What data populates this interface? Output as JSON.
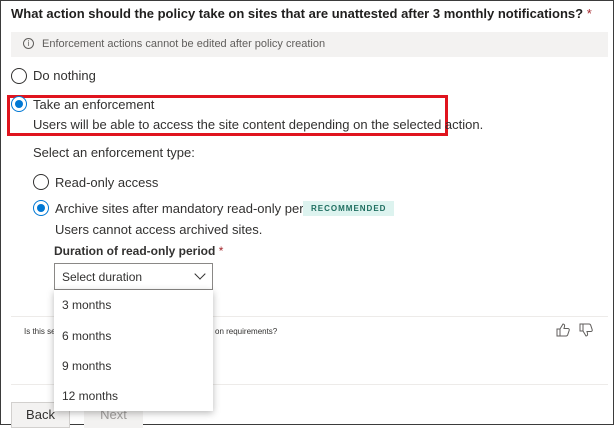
{
  "question": {
    "text": "What action should the policy take on sites that are unattested after 3 monthly notifications?",
    "required_mark": "*"
  },
  "info": {
    "icon": "info-icon",
    "glyph": "i",
    "text": "Enforcement actions cannot be edited after policy creation"
  },
  "options": {
    "do_nothing": {
      "label": "Do nothing",
      "checked": false
    },
    "take_enforcement": {
      "label": "Take an enforcement",
      "description": "Users will be able to access the site content depending on the selected action.",
      "checked": true
    }
  },
  "enforcement": {
    "heading": "Select an enforcement type:",
    "read_only": {
      "label": "Read-only access",
      "checked": false
    },
    "archive": {
      "label": "Archive sites after mandatory read-only period",
      "badge": "RECOMMENDED",
      "description": "Users cannot access archived sites.",
      "checked": true
    }
  },
  "duration": {
    "label": "Duration of read-only period",
    "required_mark": "*",
    "placeholder": "Select duration",
    "options": [
      "3 months",
      "6 months",
      "9 months",
      "12 months"
    ]
  },
  "feedback": {
    "text_left": "Is this se",
    "text_right": "on requirements?"
  },
  "buttons": {
    "back": "Back",
    "next": "Next"
  },
  "colors": {
    "accent": "#0078d4",
    "highlight_border": "#e0141e",
    "required": "#a4262c",
    "badge_bg": "#ddf3ef"
  }
}
